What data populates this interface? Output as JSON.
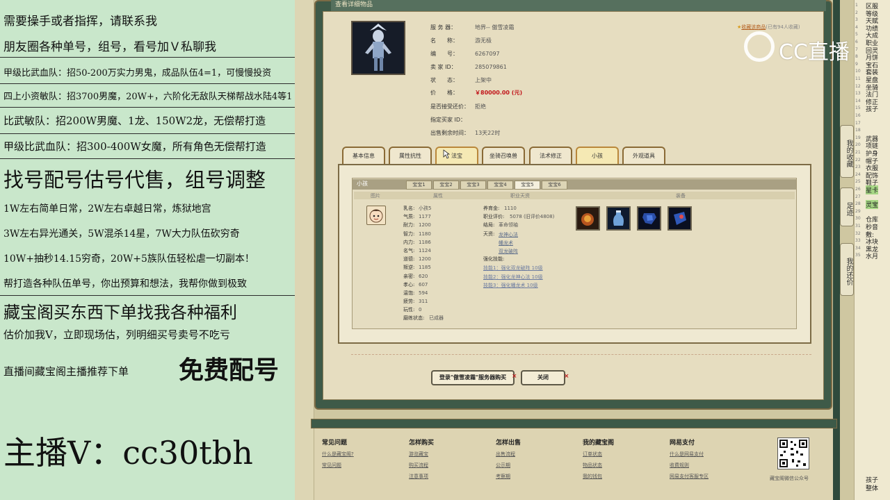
{
  "overlay": {
    "lines": [
      "需要操手或者指挥，请联系我",
      "朋友圈各种单号，组号，看号加Ｖ私聊我",
      "甲级比武血队：招50-200万实力男鬼，成品队伍4=1，可慢慢投资",
      "四上小资敏队：招3700男魔，20W+，六阶化无敌队天梯帮战水陆4等1",
      "比武敏队：招200W男魔、1龙、150W2龙，无偿帮打造",
      "甲级比武血队：招300-400W女魔，所有角色无偿帮打造",
      "找号配号估号代售，组号调整",
      "1W左右简单日常，2W左右卓越日常，炼狱地宫",
      "3W左右异光通关，5W混杀14星，7W大力队伍砍穷奇",
      "10W+抽秒14.15穷奇，20W+5族队伍轻松虐一切副本！",
      "帮打造各种队伍单号，你出预算和想法，我帮你做到极致",
      "藏宝阁买东西下单找我各种福利",
      "估价加我V，立即现场估，列明细买号卖号不吃亏",
      "直播间藏宝阁主播推荐下单",
      "免费配号",
      "主播V：cc30tbh"
    ]
  },
  "dialog": {
    "title": "查看详细物品",
    "fav_label": "收藏该商品",
    "fav_count": "(已有94人收藏)",
    "info": [
      {
        "label": "服 务 器：",
        "value": "地界-- 傲雪凌霜"
      },
      {
        "label": "名　　称：",
        "value": "游无极"
      },
      {
        "label": "编　　号：",
        "value": "6267097"
      },
      {
        "label": "卖 家 ID：",
        "value": "285079861"
      },
      {
        "label": "状　　态：",
        "value": "上架中"
      },
      {
        "label": "价　　格：",
        "value": "￥80000.00 (元)"
      },
      {
        "label": "是否接受还价：",
        "value": "拒绝"
      },
      {
        "label": "指定买家 ID：",
        "value": ""
      },
      {
        "label": "出售剩余时间：",
        "value": "13天22时"
      }
    ],
    "tabs": [
      "基本信息",
      "属性抗性",
      "法宝",
      "坐骑召唤兽",
      "法术修正",
      "小孩",
      "外观道具"
    ],
    "active_tab": "小孩",
    "panel_title": "小孩",
    "subtabs": [
      "宝宝1",
      "宝宝2",
      "宝宝3",
      "宝宝4",
      "宝宝5",
      "宝宝6"
    ],
    "active_subtab": "宝宝5",
    "columns": [
      "图片",
      "属性",
      "职业天资",
      "装备"
    ],
    "kid_attrs": [
      {
        "k": "乳名:",
        "v": "小孩5"
      },
      {
        "k": "气质:",
        "v": "1177"
      },
      {
        "k": "耐力:",
        "v": "1200"
      },
      {
        "k": "智力:",
        "v": "1180"
      },
      {
        "k": "内力:",
        "v": "1186"
      },
      {
        "k": "名气:",
        "v": "1124"
      },
      {
        "k": "道德:",
        "v": "1200"
      },
      {
        "k": "叛逆:",
        "v": "1185"
      },
      {
        "k": "亲密:",
        "v": "620"
      },
      {
        "k": "孝心:",
        "v": "607"
      },
      {
        "k": "温饱:",
        "v": "594"
      },
      {
        "k": "疲劳:",
        "v": "311"
      },
      {
        "k": "玩性:",
        "v": "0"
      },
      {
        "k": "磨练状态:",
        "v": "已成器"
      }
    ],
    "job_rows": [
      {
        "k": "养育金:",
        "v": "1110"
      },
      {
        "k": "职业评价:",
        "v": "5078 (旧评价4808)"
      },
      {
        "k": "结局:",
        "v": "革命领袖"
      },
      {
        "k": "天资:",
        "v": ""
      }
    ],
    "talents": [
      "龙神心法",
      "幡龙术",
      "双龙破阵"
    ],
    "skills_label": "强化技能:",
    "skills": [
      "技能1：强化双龙破阵 10级",
      "技能2：强化龙神心法 10级",
      "技能3：强化幡龙术 10级"
    ],
    "buttons": {
      "login": "登录\"傲雪凌霜\"服务器购买",
      "close": "关闭"
    },
    "close_x": "×"
  },
  "side_tabs": [
    "我的收藏",
    "足迹",
    "我的还价"
  ],
  "footer": {
    "cols": [
      {
        "head": "常见问题",
        "links": [
          "什么是藏宝阁?",
          "常见问题"
        ]
      },
      {
        "head": "怎样购买",
        "links": [
          "游览藏宝",
          "购买流程",
          "注意事项"
        ]
      },
      {
        "head": "怎样出售",
        "links": [
          "出售流程",
          "公示期",
          "考察期"
        ]
      },
      {
        "head": "我的藏宝阁",
        "links": [
          "订单状态",
          "物品状态",
          "我的钱包"
        ]
      },
      {
        "head": "网易支付",
        "links": [
          "什么是网易支付",
          "收费规则",
          "网易支付客服专区"
        ]
      }
    ],
    "qr_caption": "藏宝阁微信公众号"
  },
  "chat": {
    "lines": [
      "区服",
      "等级",
      "天赋",
      "功绩",
      "大成",
      "职业",
      "回灵",
      "月饼",
      "宝石",
      "套装",
      "星盘",
      "坐骑",
      "法门",
      "修正",
      "孩子",
      "",
      "",
      "",
      "武器",
      "项链",
      "护身",
      "帽子",
      "衣服",
      "配饰",
      "鞋子",
      "星卡",
      "",
      "灵宝",
      "",
      "仓库",
      "秒音",
      "敷:",
      "冰块",
      "黑龙",
      "水月"
    ],
    "bottom": [
      "孩子",
      "整体"
    ]
  },
  "watermark": "CC直播"
}
